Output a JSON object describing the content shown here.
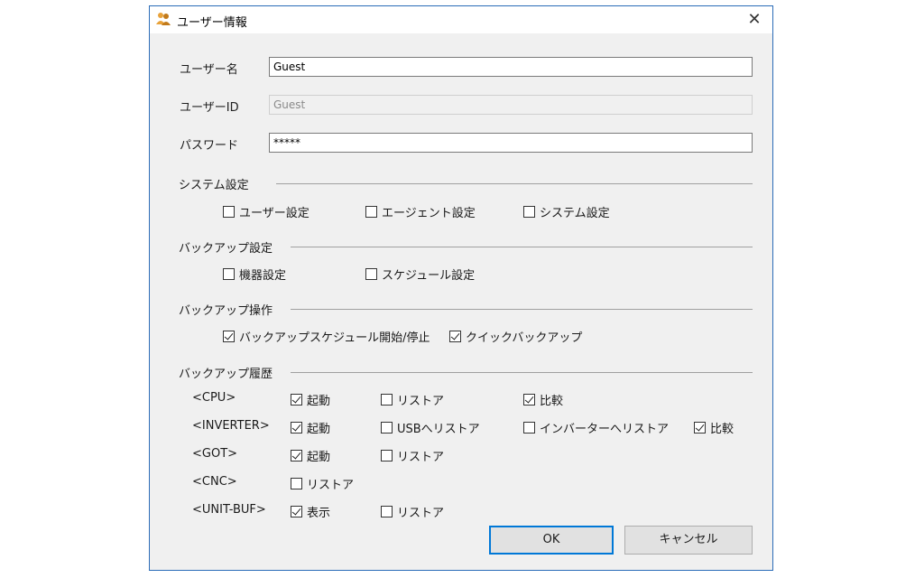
{
  "window": {
    "title": "ユーザー情報",
    "close_glyph": "✕"
  },
  "form": {
    "user_name": {
      "label": "ユーザー名",
      "value": "Guest"
    },
    "user_id": {
      "label": "ユーザーID",
      "value": "Guest"
    },
    "password": {
      "label": "パスワード",
      "value": "*****"
    }
  },
  "system_settings": {
    "header": "システム設定",
    "items": [
      {
        "label": "ユーザー設定",
        "checked": false
      },
      {
        "label": "エージェント設定",
        "checked": false
      },
      {
        "label": "システム設定",
        "checked": false
      }
    ]
  },
  "backup_settings": {
    "header": "バックアップ設定",
    "items": [
      {
        "label": "機器設定",
        "checked": false
      },
      {
        "label": "スケジュール設定",
        "checked": false
      }
    ]
  },
  "backup_operation": {
    "header": "バックアップ操作",
    "items": [
      {
        "label": "バックアップスケジュール開始/停止",
        "checked": true
      },
      {
        "label": "クイックバックアップ",
        "checked": true
      }
    ]
  },
  "backup_history": {
    "header": "バックアップ履歴",
    "rows": [
      {
        "label": "<CPU>",
        "items": [
          {
            "label": "起動",
            "checked": true
          },
          {
            "label": "リストア",
            "checked": false
          },
          {
            "label": "比較",
            "checked": true
          }
        ]
      },
      {
        "label": "<INVERTER>",
        "items": [
          {
            "label": "起動",
            "checked": true
          },
          {
            "label": "USBへリストア",
            "checked": false
          },
          {
            "label": "インバーターへリストア",
            "checked": false
          },
          {
            "label": "比較",
            "checked": true
          }
        ]
      },
      {
        "label": "<GOT>",
        "items": [
          {
            "label": "起動",
            "checked": true
          },
          {
            "label": "リストア",
            "checked": false
          }
        ]
      },
      {
        "label": "<CNC>",
        "items": [
          {
            "label": "リストア",
            "checked": false
          }
        ]
      },
      {
        "label": "<UNIT-BUF>",
        "items": [
          {
            "label": "表示",
            "checked": true
          },
          {
            "label": "リストア",
            "checked": false
          }
        ]
      }
    ]
  },
  "buttons": {
    "ok": "OK",
    "cancel": "キャンセル"
  },
  "colors": {
    "accent": "#0078d7",
    "border": "#2b6cb8",
    "dialog_bg": "#f0f0f0"
  }
}
